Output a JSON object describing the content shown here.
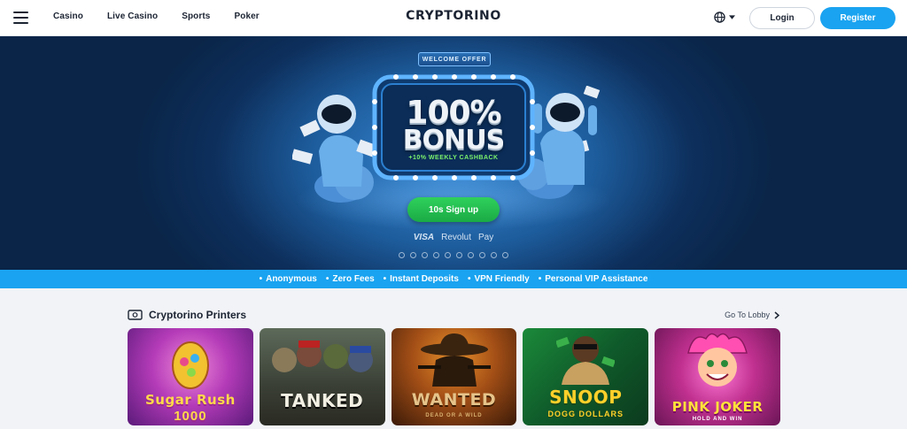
{
  "header": {
    "menu_icon": "hamburger-icon",
    "nav": [
      "Casino",
      "Live Casino",
      "Sports",
      "Poker"
    ],
    "logo": "CRYPTORINO",
    "language_icon": "globe-icon",
    "login_label": "Login",
    "register_label": "Register"
  },
  "hero": {
    "tag": "WELCOME OFFER",
    "bonus_line1": "100%",
    "bonus_line2": "BONUS",
    "cashback": "+10% WEEKLY CASHBACK",
    "signup_label": "10s Sign up",
    "payments": [
      "VISA",
      "Revolut",
      " Pay"
    ],
    "crypto_icons": [
      "bitcoin-icon",
      "ethereum-icon",
      "tether-icon",
      "tron-icon",
      "xrp-icon",
      "litecoin-icon",
      "dogecoin-icon",
      "cardano-icon",
      "solana-icon",
      "chainlink-icon"
    ],
    "colors": {
      "accent_green": "#22c04f",
      "cashback_green": "#7cf26b"
    }
  },
  "features": [
    "Anonymous",
    "Zero Fees",
    "Instant Deposits",
    "VPN Friendly",
    "Personal VIP Assistance"
  ],
  "section": {
    "title": "Cryptorino Printers",
    "title_icon": "cash-icon",
    "lobby_label": "Go To Lobby",
    "games": [
      {
        "name": "Sugar Rush 1000",
        "title": "Sugar Rush",
        "sub": "1000"
      },
      {
        "name": "Tanked",
        "title": "TANKED",
        "sub": ""
      },
      {
        "name": "Wanted Dead or a Wild",
        "title": "WANTED",
        "sub": "DEAD OR A WILD"
      },
      {
        "name": "Snoop Dogg Dollars",
        "title": "SNOOP",
        "sub": "DOGG DOLLARS"
      },
      {
        "name": "Pink Joker",
        "title": "PINK JOKER",
        "sub": "HOLD AND WIN"
      }
    ]
  },
  "colors": {
    "brand_blue": "#1aa3f0",
    "text_dark": "#1c2433"
  }
}
